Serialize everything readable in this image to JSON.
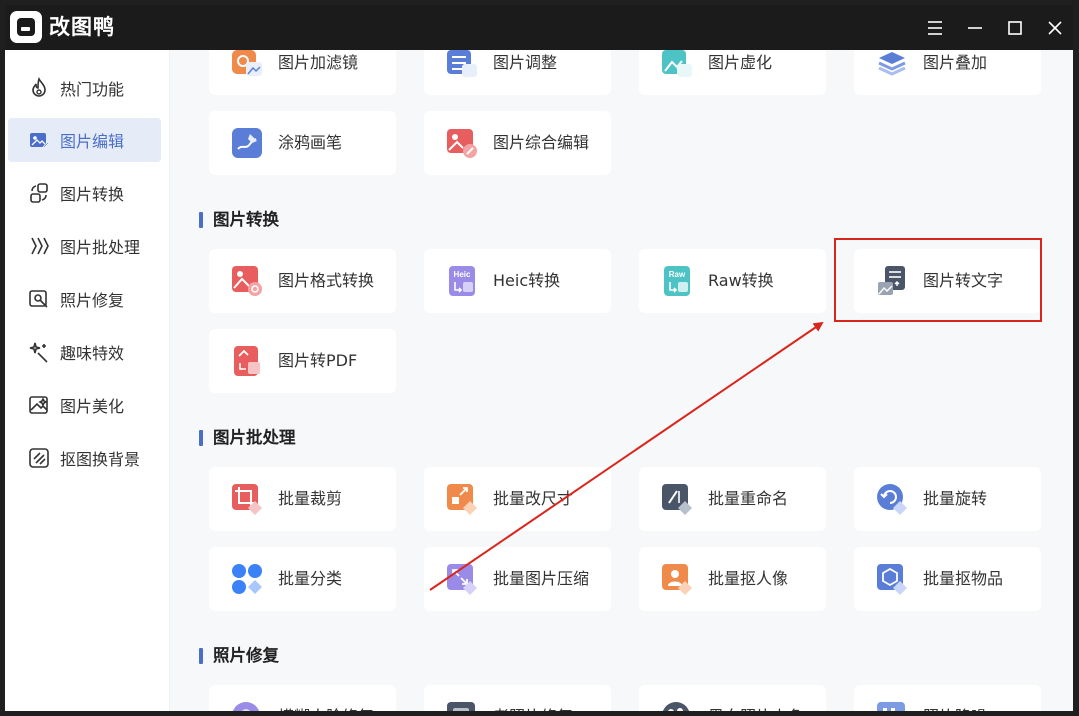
{
  "app": {
    "title": "改图鸭"
  },
  "window_controls": [
    "menu-icon",
    "minimize-icon",
    "maximize-icon",
    "close-icon"
  ],
  "sidebar": {
    "items": [
      {
        "label": "热门功能",
        "icon": "flame-icon"
      },
      {
        "label": "图片编辑",
        "icon": "image-edit-icon",
        "active": true
      },
      {
        "label": "图片转换",
        "icon": "convert-icon"
      },
      {
        "label": "图片批处理",
        "icon": "batch-icon"
      },
      {
        "label": "照片修复",
        "icon": "photo-repair-icon"
      },
      {
        "label": "趣味特效",
        "icon": "sparkle-icon"
      },
      {
        "label": "图片美化",
        "icon": "beautify-icon"
      },
      {
        "label": "抠图换背景",
        "icon": "cutout-icon"
      }
    ]
  },
  "main": {
    "top_row": [
      {
        "label": "图片加滤镜",
        "icon": "filter-icon"
      },
      {
        "label": "图片调整",
        "icon": "adjust-icon"
      },
      {
        "label": "图片虚化",
        "icon": "blur-icon"
      },
      {
        "label": "图片叠加",
        "icon": "overlay-icon"
      }
    ],
    "edit_row2": [
      {
        "label": "涂鸦画笔",
        "icon": "brush-icon"
      },
      {
        "label": "图片综合编辑",
        "icon": "comprehensive-edit-icon"
      }
    ],
    "sections": [
      {
        "title": "图片转换",
        "items": [
          {
            "label": "图片格式转换",
            "icon": "format-convert-icon"
          },
          {
            "label": "Heic转换",
            "icon": "heic-icon",
            "badge": "Heic"
          },
          {
            "label": "Raw转换",
            "icon": "raw-icon",
            "badge": "Raw"
          },
          {
            "label": "图片转文字",
            "icon": "image-to-text-icon",
            "highlighted": true
          },
          {
            "label": "图片转PDF",
            "icon": "pdf-icon"
          }
        ]
      },
      {
        "title": "图片批处理",
        "items": [
          {
            "label": "批量裁剪",
            "icon": "batch-crop-icon"
          },
          {
            "label": "批量改尺寸",
            "icon": "batch-resize-icon"
          },
          {
            "label": "批量重命名",
            "icon": "batch-rename-icon"
          },
          {
            "label": "批量旋转",
            "icon": "batch-rotate-icon"
          },
          {
            "label": "批量分类",
            "icon": "batch-classify-icon"
          },
          {
            "label": "批量图片压缩",
            "icon": "batch-compress-icon"
          },
          {
            "label": "批量抠人像",
            "icon": "batch-portrait-icon"
          },
          {
            "label": "批量抠物品",
            "icon": "batch-object-icon"
          }
        ]
      },
      {
        "title": "照片修复",
        "items": [
          {
            "label": "模糊人脸修复",
            "icon": "face-repair-icon"
          },
          {
            "label": "老照片修复",
            "icon": "old-photo-icon"
          },
          {
            "label": "黑白照片上色",
            "icon": "colorize-icon"
          },
          {
            "label": "照片降噪",
            "icon": "denoise-icon"
          }
        ]
      }
    ]
  },
  "colors": {
    "accent": "#4b6fc8",
    "titlebar": "#1b1b1b",
    "annotation_red": "#d9261c",
    "main_bg": "#f7f8fa"
  }
}
